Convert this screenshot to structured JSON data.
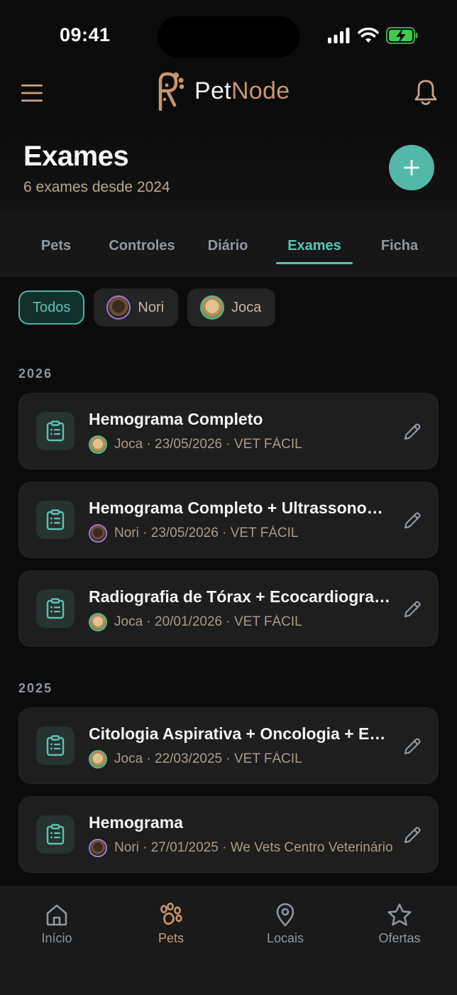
{
  "status": {
    "time": "09:41"
  },
  "header": {
    "logo_part1": "Pet",
    "logo_part2": "Node"
  },
  "page": {
    "title": "Exames",
    "subtitle": "6 exames desde 2024"
  },
  "tabs": [
    {
      "label": "Pets",
      "active": false
    },
    {
      "label": "Controles",
      "active": false
    },
    {
      "label": "Diário",
      "active": false
    },
    {
      "label": "Exames",
      "active": true
    },
    {
      "label": "Ficha",
      "active": false
    }
  ],
  "filters": [
    {
      "label": "Todos",
      "active": true
    },
    {
      "label": "Nori",
      "active": false
    },
    {
      "label": "Joca",
      "active": false
    }
  ],
  "sections": [
    {
      "year": "2026",
      "exams": [
        {
          "title": "Hemograma Completo",
          "pet": "joca",
          "meta": "Joca · 23/05/2026 · VET FÁCIL"
        },
        {
          "title": "Hemograma Completo + Ultrassonografia",
          "pet": "nori",
          "meta": "Nori · 23/05/2026 · VET FÁCIL"
        },
        {
          "title": "Radiografia de Tórax + Ecocardiograma",
          "pet": "joca",
          "meta": "Joca · 20/01/2026 · VET FÁCIL"
        }
      ]
    },
    {
      "year": "2025",
      "exams": [
        {
          "title": "Citologia Aspirativa + Oncologia + Exames",
          "pet": "joca",
          "meta": "Joca · 22/03/2025 · VET FÁCIL"
        },
        {
          "title": "Hemograma",
          "pet": "nori",
          "meta": "Nori · 27/01/2025 · We Vets Centro Veterinário"
        }
      ]
    }
  ],
  "nav": [
    {
      "label": "Início",
      "active": false
    },
    {
      "label": "Pets",
      "active": true
    },
    {
      "label": "Locais",
      "active": false
    },
    {
      "label": "Ofertas",
      "active": false
    }
  ],
  "colors": {
    "accent": "#53b8a8",
    "brand": "#c8956c",
    "background": "#0b0b0b",
    "card": "#1e1e1e"
  }
}
